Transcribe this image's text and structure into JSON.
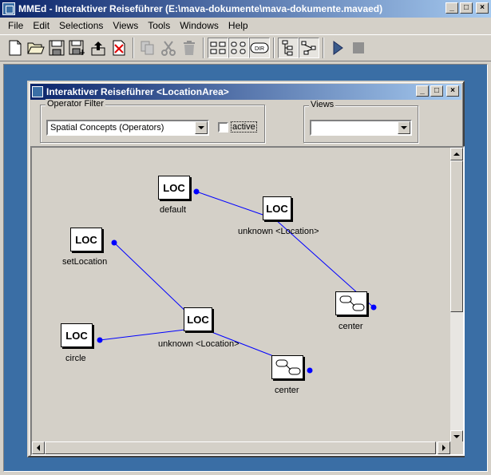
{
  "window": {
    "title": "MMEd - Interaktiver Reiseführer (E:\\mava-dokumente\\mava-dokumente.mavaed)",
    "minimize": "_",
    "maximize": "□",
    "close": "×"
  },
  "menu": [
    "File",
    "Edit",
    "Selections",
    "Views",
    "Tools",
    "Windows",
    "Help"
  ],
  "toolbar": {
    "buttons": [
      "new-icon",
      "open-icon",
      "save-icon",
      "save-as-icon",
      "export-icon",
      "delete-file-icon",
      "copy-icon",
      "cut-icon",
      "trash-icon",
      "layout-grid-icon",
      "layout-dots-icon",
      "dir-icon",
      "tree-icon",
      "graph-icon",
      "play-icon",
      "stop-icon"
    ],
    "dir_label": "DIR"
  },
  "inner": {
    "title": "Interaktiver Reiseführer <LocationArea>",
    "operator_filter_label": "Operator Filter",
    "operator_filter_value": "Spatial Concepts (Operators)",
    "active_label": "active",
    "views_label": "Views",
    "views_value": ""
  },
  "nodes": {
    "loc_text": "LOC",
    "default_label": "default",
    "unknown1_label": "unknown <Location>",
    "setlocation_label": "setLocation",
    "unknown2_label": "unknown <Location>",
    "circle_label": "circle",
    "center1_label": "center",
    "center2_label": "center"
  },
  "colors": {
    "edge": "#0000ff",
    "titlebar_start": "#0a246a",
    "titlebar_end": "#a6caf0",
    "desktop": "#3a6ea5"
  }
}
